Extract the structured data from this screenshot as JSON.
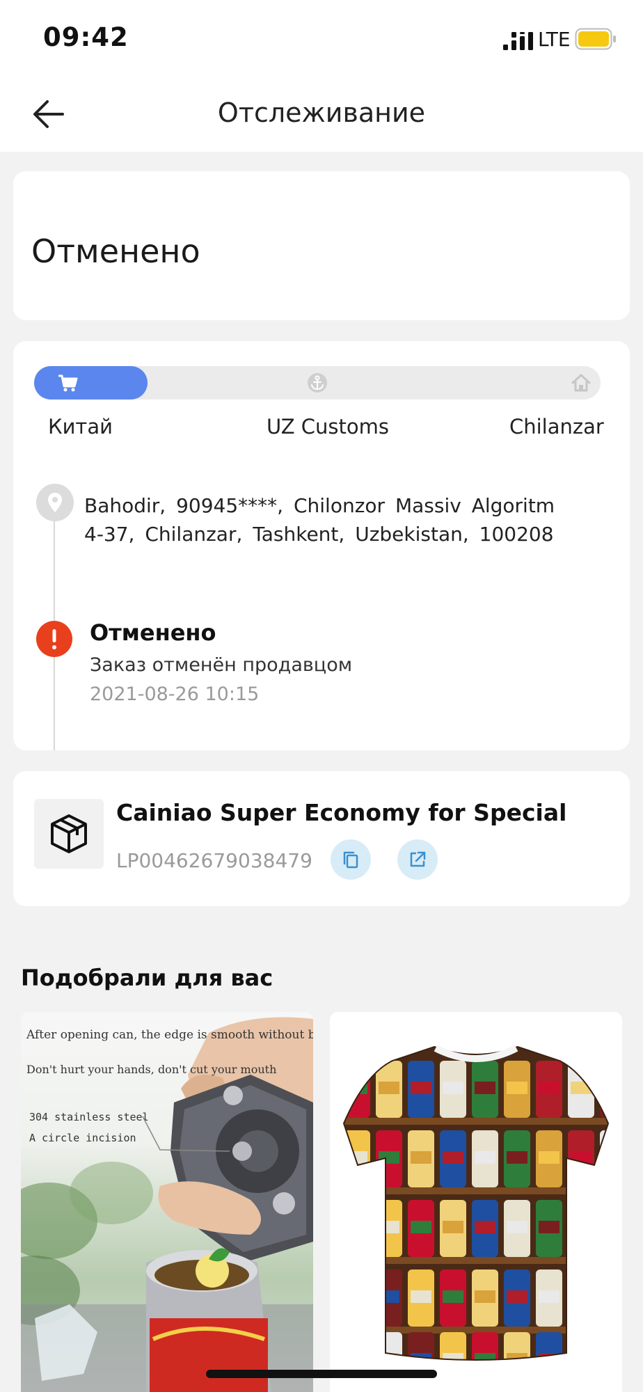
{
  "status_bar": {
    "time": "09:42",
    "network": "LTE",
    "battery_color": "#f6c910"
  },
  "nav": {
    "title": "Отслеживание",
    "back_icon": "arrow-left-icon"
  },
  "order_status": {
    "text": "Отменено"
  },
  "tracking": {
    "progress_fraction": 0.2,
    "accent_color": "#5b86ee",
    "stages": [
      {
        "label": "Китай",
        "icon": "cart-icon"
      },
      {
        "label": "UZ Customs",
        "icon": "anchor-icon"
      },
      {
        "label": "Chilanzar",
        "icon": "home-icon"
      }
    ],
    "address_line1": "Bahodir, 90945****, Chilonzor Massiv Algoritm",
    "address_line2": "4-37, Chilanzar, Tashkent, Uzbekistan, 100208",
    "event": {
      "title": "Отменено",
      "description": "Заказ отменён продавцом",
      "time": "2021-08-26 10:15",
      "color": "#e8401d"
    }
  },
  "carrier": {
    "name": "Cainiao Super Economy for Special",
    "tracking_number": "LP00462679038479",
    "copy_icon": "copy-icon",
    "open_icon": "external-link-icon"
  },
  "recommendations": {
    "title": "Подобрали для вас",
    "products": [
      {
        "name": "can-opener",
        "texts": [
          "After opening can, the edge is smooth without burr",
          "Don't hurt your hands, don't cut your mouth",
          "304 stainless steel",
          "A circle incision"
        ]
      },
      {
        "name": "beer-can-tshirt"
      }
    ]
  }
}
